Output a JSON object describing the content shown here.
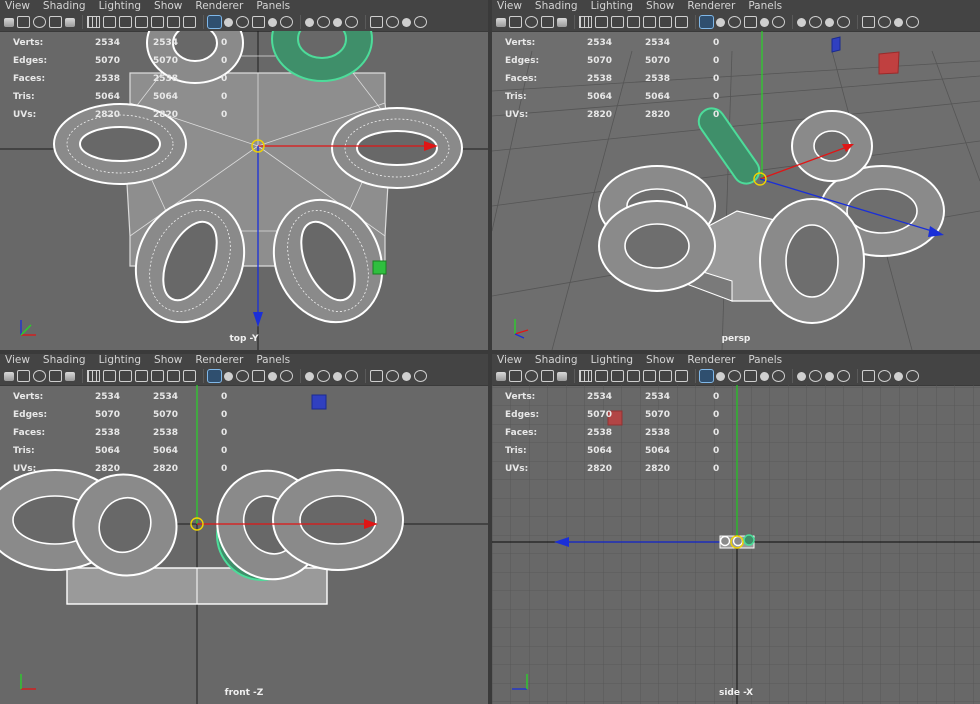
{
  "menu": [
    "View",
    "Shading",
    "Lighting",
    "Show",
    "Renderer",
    "Panels"
  ],
  "hud": {
    "labels": [
      "Verts:",
      "Edges:",
      "Faces:",
      "Tris:",
      "UVs:"
    ],
    "col1": [
      "2534",
      "5070",
      "2538",
      "5064",
      "2820"
    ],
    "col2": [
      "2534",
      "5070",
      "2538",
      "5064",
      "2820"
    ],
    "col3": [
      "0",
      "0",
      "0",
      "0",
      "0"
    ]
  },
  "viewports": {
    "top": {
      "label": "top -Y"
    },
    "persp": {
      "label": "persp"
    },
    "front": {
      "label": "front -Z"
    },
    "side": {
      "label": "side -X"
    }
  },
  "colors": {
    "wire": "#ffffff",
    "selected": "#4ddc9a",
    "axis_x": "#e01515",
    "axis_y": "#28d428",
    "axis_z": "#1a2fd8",
    "viewport_bg": "#686868"
  },
  "icons": [
    "camera-icon",
    "grid-toggle-icon",
    "wireframe-icon",
    "smooth-shade-icon",
    "texture-icon",
    "light-icon",
    "shadow-icon",
    "isolate-icon",
    "xray-icon",
    "resolution-gate-icon"
  ]
}
